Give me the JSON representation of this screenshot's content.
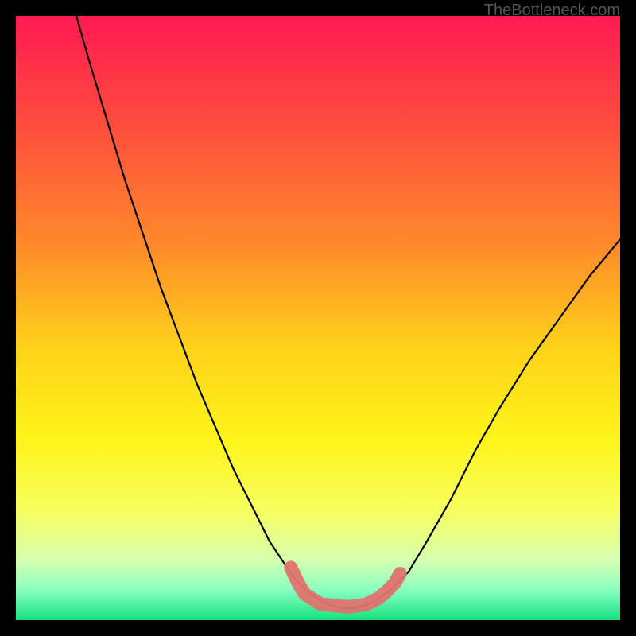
{
  "watermark": "TheBottleneck.com",
  "chart_data": {
    "type": "line",
    "title": "",
    "xlabel": "",
    "ylabel": "",
    "xlim": [
      0,
      100
    ],
    "ylim": [
      0,
      100
    ],
    "gradient_stops": [
      {
        "pos": 0.0,
        "color": "#ff1a52"
      },
      {
        "pos": 0.18,
        "color": "#ff4c3d"
      },
      {
        "pos": 0.38,
        "color": "#ff8a2a"
      },
      {
        "pos": 0.55,
        "color": "#ffd21a"
      },
      {
        "pos": 0.7,
        "color": "#fff41a"
      },
      {
        "pos": 0.82,
        "color": "#f6ff60"
      },
      {
        "pos": 0.9,
        "color": "#d8ffb0"
      },
      {
        "pos": 0.95,
        "color": "#8affc0"
      },
      {
        "pos": 1.0,
        "color": "#16e27e"
      }
    ],
    "series": [
      {
        "name": "curve",
        "stroke": "#000000",
        "x": [
          10,
          12,
          15,
          18,
          21,
          24,
          27,
          30,
          33,
          36,
          38,
          40,
          42,
          44,
          46,
          48,
          50,
          52,
          54,
          56,
          58,
          60,
          62,
          65,
          68,
          72,
          76,
          80,
          85,
          90,
          95,
          100
        ],
        "y": [
          100,
          93,
          83,
          73,
          64,
          55,
          47,
          39,
          32,
          25,
          21,
          17,
          13,
          10,
          7,
          5,
          3.5,
          2.5,
          2,
          2,
          2.5,
          3.5,
          5,
          8,
          13,
          20,
          28,
          35,
          43,
          50,
          57,
          63
        ]
      }
    ],
    "marker_path": {
      "name": "highlight",
      "stroke": "#e0736f",
      "points": [
        {
          "x": 45.5,
          "y": 8.7
        },
        {
          "x": 46.8,
          "y": 6.0
        },
        {
          "x": 47.8,
          "y": 4.3
        },
        {
          "x": 50.5,
          "y": 2.6
        },
        {
          "x": 55.0,
          "y": 2.2
        },
        {
          "x": 58.0,
          "y": 2.6
        },
        {
          "x": 60.0,
          "y": 3.6
        },
        {
          "x": 61.2,
          "y": 4.6
        },
        {
          "x": 62.6,
          "y": 6.0
        },
        {
          "x": 63.6,
          "y": 7.7
        }
      ]
    }
  }
}
